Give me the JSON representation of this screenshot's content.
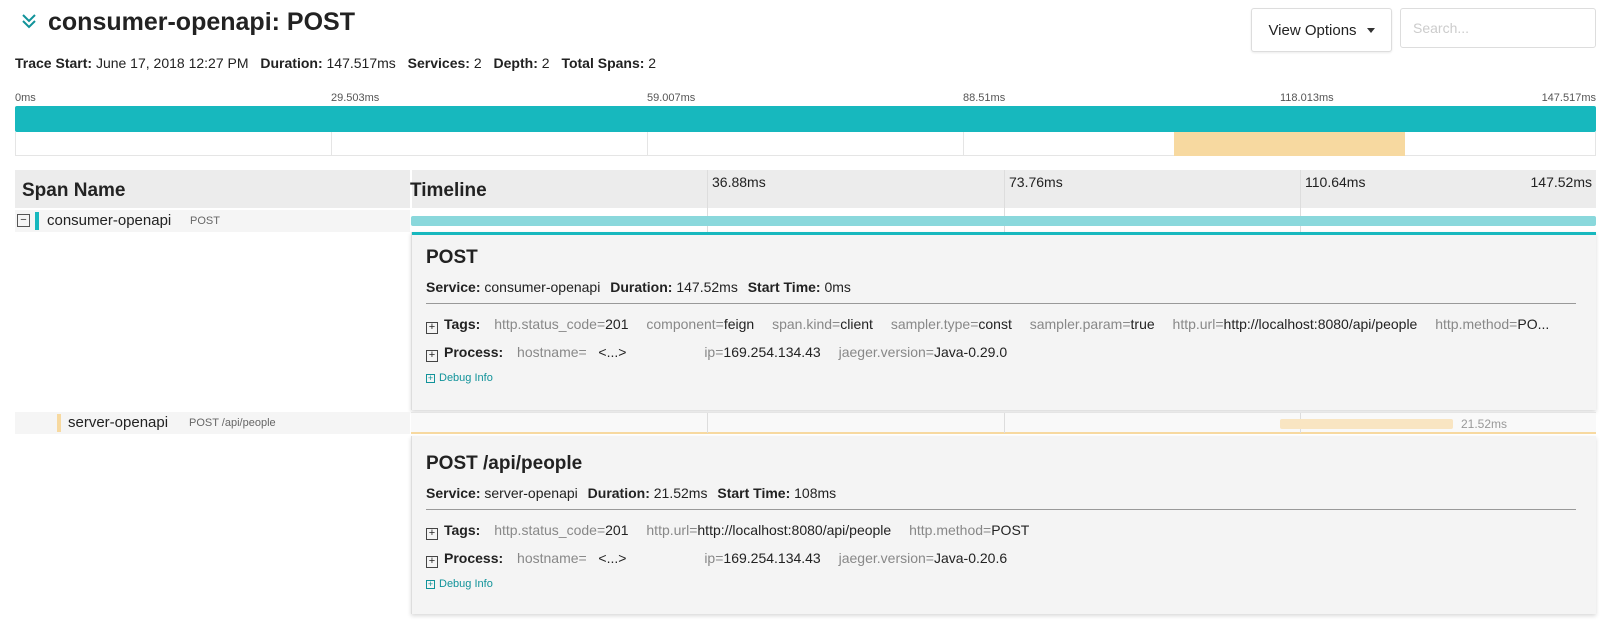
{
  "header": {
    "title": "consumer-openapi: POST",
    "view_options_label": "View Options",
    "search_placeholder": "Search..."
  },
  "trace_meta": {
    "trace_start_label": "Trace Start:",
    "trace_start": "June 17, 2018 12:27 PM",
    "duration_label": "Duration:",
    "duration": "147.517ms",
    "services_label": "Services:",
    "services": "2",
    "depth_label": "Depth:",
    "depth": "2",
    "total_spans_label": "Total Spans:",
    "total_spans": "2"
  },
  "minimap": {
    "ticks": [
      "0ms",
      "29.503ms",
      "59.007ms",
      "88.51ms",
      "118.013ms",
      "147.517ms"
    ]
  },
  "table": {
    "span_name_header": "Span Name",
    "timeline_header": "Timeline",
    "ticks": [
      "36.88ms",
      "73.76ms",
      "110.64ms",
      "147.52ms"
    ]
  },
  "spans": [
    {
      "service": "consumer-openapi",
      "operation": "POST",
      "toggle": "−",
      "color": "#17b8be",
      "detail": {
        "title": "POST",
        "service_label": "Service:",
        "service": "consumer-openapi",
        "duration_label": "Duration:",
        "duration": "147.52ms",
        "start_label": "Start Time:",
        "start": "0ms",
        "tags_label": "Tags:",
        "tags": [
          {
            "k": "http.status_code",
            "v": "201"
          },
          {
            "k": "component",
            "v": "feign"
          },
          {
            "k": "span.kind",
            "v": "client"
          },
          {
            "k": "sampler.type",
            "v": "const"
          },
          {
            "k": "sampler.param",
            "v": "true"
          },
          {
            "k": "http.url",
            "v": "http://localhost:8080/api/people"
          },
          {
            "k": "http.method",
            "v": "PO..."
          }
        ],
        "process_label": "Process:",
        "process": {
          "hostname_key": "hostname",
          "hostname_val": "<...>",
          "ip_key": "ip",
          "ip_val": "169.254.134.43",
          "jaeger_key": "jaeger.version",
          "jaeger_val": "Java-0.29.0"
        },
        "debug_label": "Debug Info"
      }
    },
    {
      "service": "server-openapi",
      "operation": "POST /api/people",
      "color": "#f7d9a0",
      "bar_duration": "21.52ms",
      "detail": {
        "title": "POST /api/people",
        "service_label": "Service:",
        "service": "server-openapi",
        "duration_label": "Duration:",
        "duration": "21.52ms",
        "start_label": "Start Time:",
        "start": "108ms",
        "tags_label": "Tags:",
        "tags": [
          {
            "k": "http.status_code",
            "v": "201"
          },
          {
            "k": "http.url",
            "v": "http://localhost:8080/api/people"
          },
          {
            "k": "http.method",
            "v": "POST"
          }
        ],
        "process_label": "Process:",
        "process": {
          "hostname_key": "hostname",
          "hostname_val": "<...>",
          "ip_key": "ip",
          "ip_val": "169.254.134.43",
          "jaeger_key": "jaeger.version",
          "jaeger_val": "Java-0.20.6"
        },
        "debug_label": "Debug Info"
      }
    }
  ],
  "colors": {
    "accent": "#17b8be",
    "span1_light": "#8ad8dc",
    "span2": "#f7d9a0",
    "span2_light": "#f9e5c2",
    "debug_link": "#11939a"
  },
  "icons": {
    "collapse": "chevron-double-down-icon",
    "view_options_caret": "caret-down-icon",
    "toggle": "minus-square-icon",
    "expand": "plus-square-icon"
  }
}
